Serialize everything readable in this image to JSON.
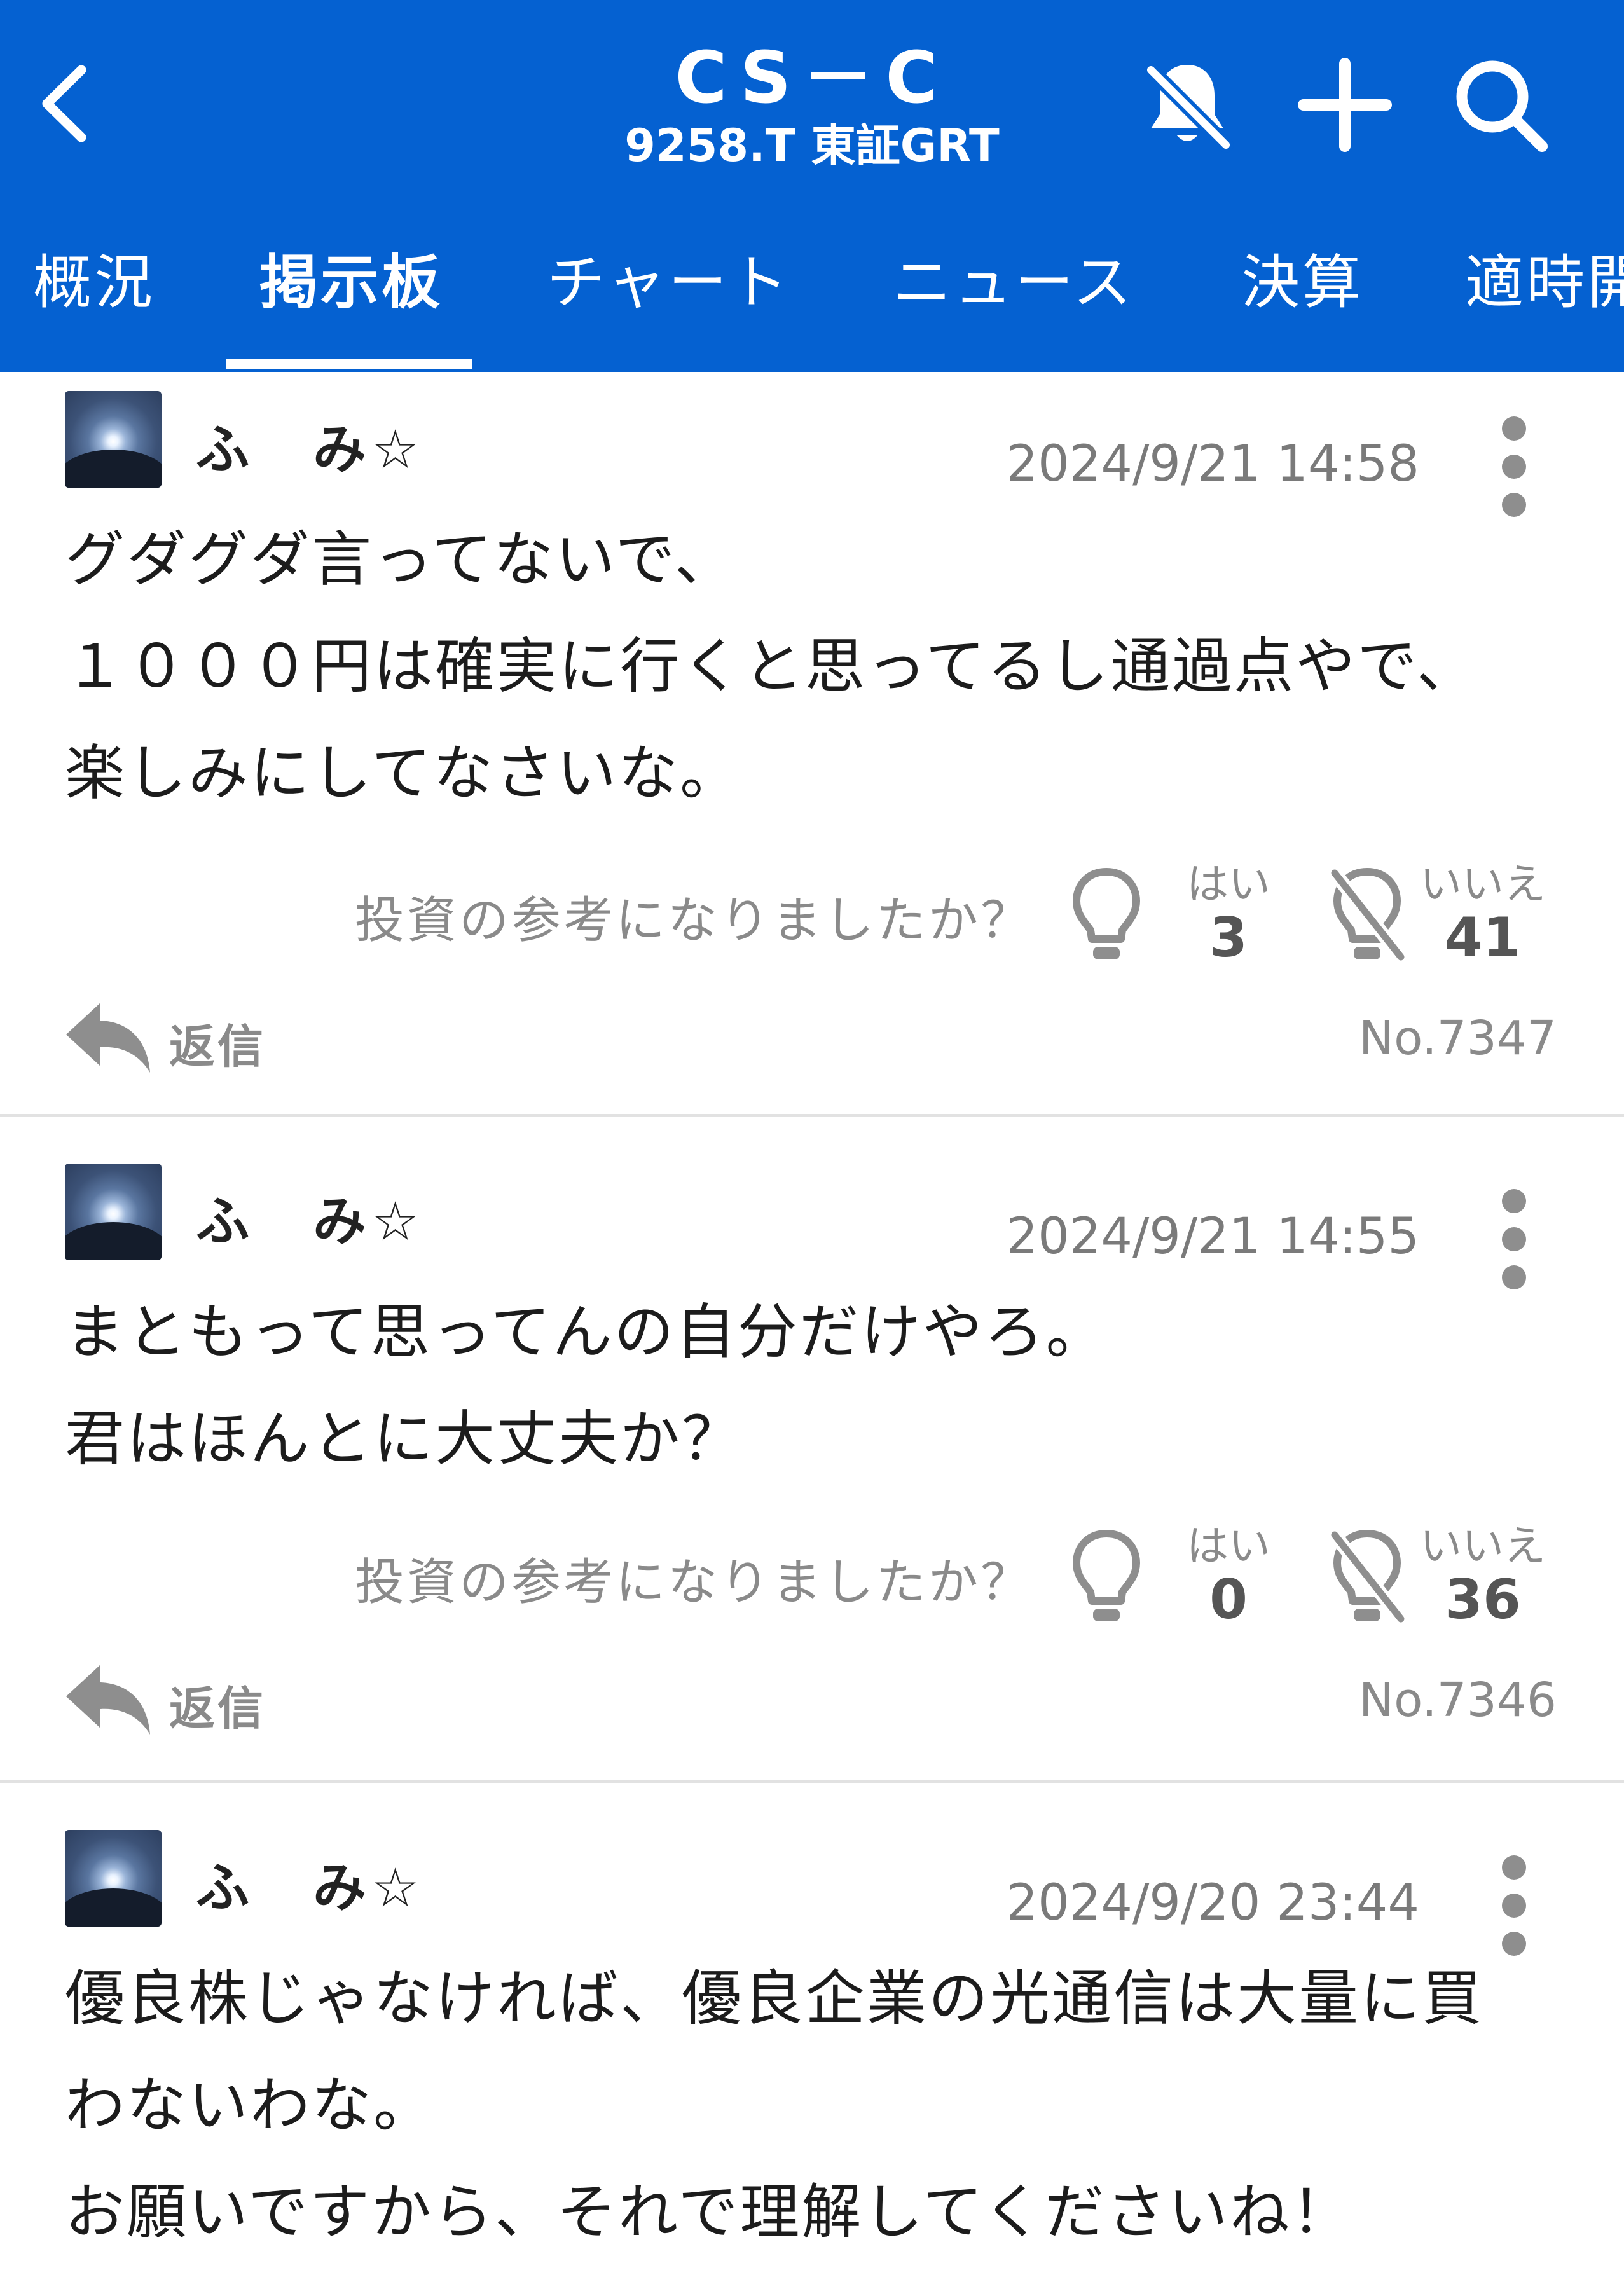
{
  "header": {
    "title": "CS－C",
    "subtitle": "9258.T 東証GRT",
    "bg_color": "#0561d1"
  },
  "icons": {
    "back": "chevron-left-icon",
    "notifications": "bell-off-icon",
    "add": "plus-icon",
    "search": "search-icon"
  },
  "tabs": [
    {
      "label": "概況",
      "active": false
    },
    {
      "label": "掲示板",
      "active": true
    },
    {
      "label": "チャート",
      "active": false
    },
    {
      "label": "ニュース",
      "active": false
    },
    {
      "label": "決算",
      "active": false
    },
    {
      "label": "適時開",
      "active": false
    }
  ],
  "posts": [
    {
      "user": "ふ　み☆",
      "timestamp": "2024/9/21 14:58",
      "body": "グダグダ言ってないで、\n１０００円は確実に行くと思ってるし通過点やで、\n楽しみにしてなさいな。",
      "helpful_question": "投資の参考になりましたか？",
      "yes_label": "はい",
      "yes_count": "3",
      "no_label": "いいえ",
      "no_count": "41",
      "reply_label": "返信",
      "number": "No.7347"
    },
    {
      "user": "ふ　み☆",
      "timestamp": "2024/9/21 14:55",
      "body": "まともって思ってんの自分だけやろ。\n君はほんとに大丈夫か？",
      "helpful_question": "投資の参考になりましたか？",
      "yes_label": "はい",
      "yes_count": "0",
      "no_label": "いいえ",
      "no_count": "36",
      "reply_label": "返信",
      "number": "No.7346"
    },
    {
      "user": "ふ　み☆",
      "timestamp": "2024/9/20 23:44",
      "body": "優良株じゃなければ、優良企業の光通信は大量に買\nわないわな。\nお願いですから、それで理解してくださいね！"
    }
  ]
}
